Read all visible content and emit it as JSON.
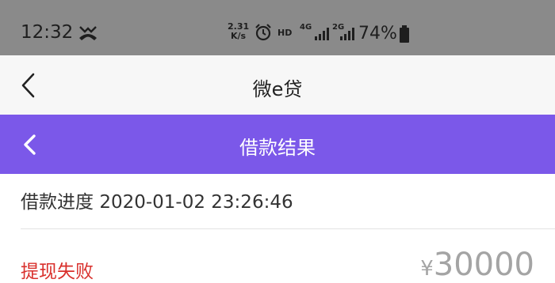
{
  "status_bar": {
    "time": "12:32",
    "net_speed_value": "2.31",
    "net_speed_unit": "K/s",
    "hd": "HD",
    "network1": "4G",
    "network2": "2G",
    "battery": "74%"
  },
  "app_bar": {
    "title": "微e贷"
  },
  "header": {
    "title": "借款结果"
  },
  "content": {
    "progress_label": "借款进度",
    "progress_time": "2020-01-02 23:26:46",
    "status": "提现失败",
    "currency": "¥",
    "amount": "30000"
  },
  "colors": {
    "header_bg": "#7b58e9",
    "failed": "#d9302c",
    "status_bar_bg": "#8a8a8a"
  }
}
